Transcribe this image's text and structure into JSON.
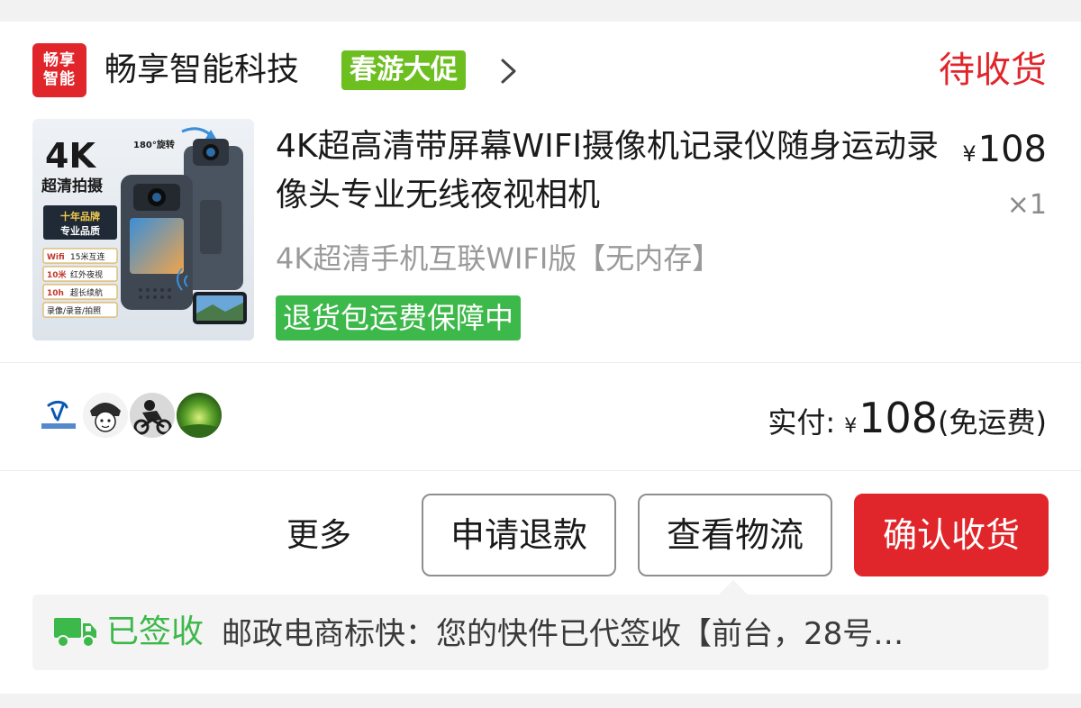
{
  "shop": {
    "logo_line1": "畅享",
    "logo_line2": "智能",
    "name": "畅享智能科技",
    "promo_badge": "春游大促"
  },
  "order": {
    "status": "待收货"
  },
  "product": {
    "title": "4K超高清带屏幕WIFI摄像机记录仪随身运动录像头专业无线夜视相机",
    "price_symbol": "¥",
    "price": "108",
    "quantity": "×1",
    "variant": "4K超清手机互联WIFI版【无内存】",
    "guarantee_tag": "退货包运费保障中",
    "image_text": {
      "resolution": "4K",
      "subtitle": "超清拍摄",
      "rotate_label": "180°旋转",
      "brand_line1": "十年品牌",
      "brand_line2": "专业品质",
      "features": [
        {
          "key": "Wifi",
          "text": "15米互连"
        },
        {
          "key": "10米",
          "text": "红外夜视"
        },
        {
          "key": "10h",
          "text": "超长续航"
        },
        {
          "key": "",
          "text": "录像/录音/拍照"
        }
      ]
    }
  },
  "summary": {
    "paid_label": "实付:",
    "currency_symbol": "¥",
    "amount": "108",
    "shipping_note": "(免运费)"
  },
  "actions": {
    "more": "更多",
    "refund": "申请退款",
    "logistics": "查看物流",
    "confirm": "确认收货"
  },
  "logistics": {
    "status": "已签收",
    "detail": "邮政电商标快：您的快件已代签收【前台，28号…"
  },
  "colors": {
    "accent_red": "#e0262b",
    "promo_green": "#6cbf1f",
    "status_green": "#3db84a"
  }
}
